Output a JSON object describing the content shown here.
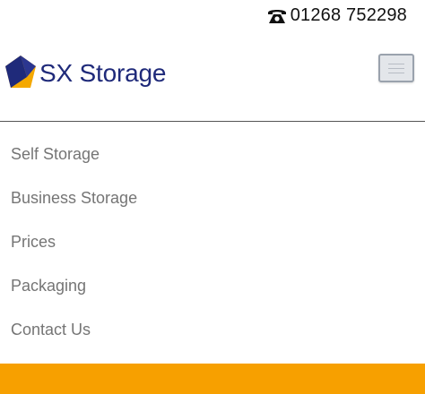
{
  "header": {
    "phone_icon": "telephone-icon",
    "phone_number": "01268 752298"
  },
  "brand": {
    "name": "SX Storage",
    "logo_icon": "sx-storage-logo-icon",
    "colors": {
      "navy": "#1f2a7a",
      "gold": "#f4a800",
      "orange": "#f7a000"
    }
  },
  "menu_toggle": {
    "icon": "hamburger-menu-icon"
  },
  "nav": {
    "items": [
      {
        "label": "Self Storage"
      },
      {
        "label": "Business Storage"
      },
      {
        "label": "Prices"
      },
      {
        "label": "Packaging"
      },
      {
        "label": "Contact Us"
      }
    ]
  },
  "footer_band": {
    "color": "#f7a000"
  }
}
